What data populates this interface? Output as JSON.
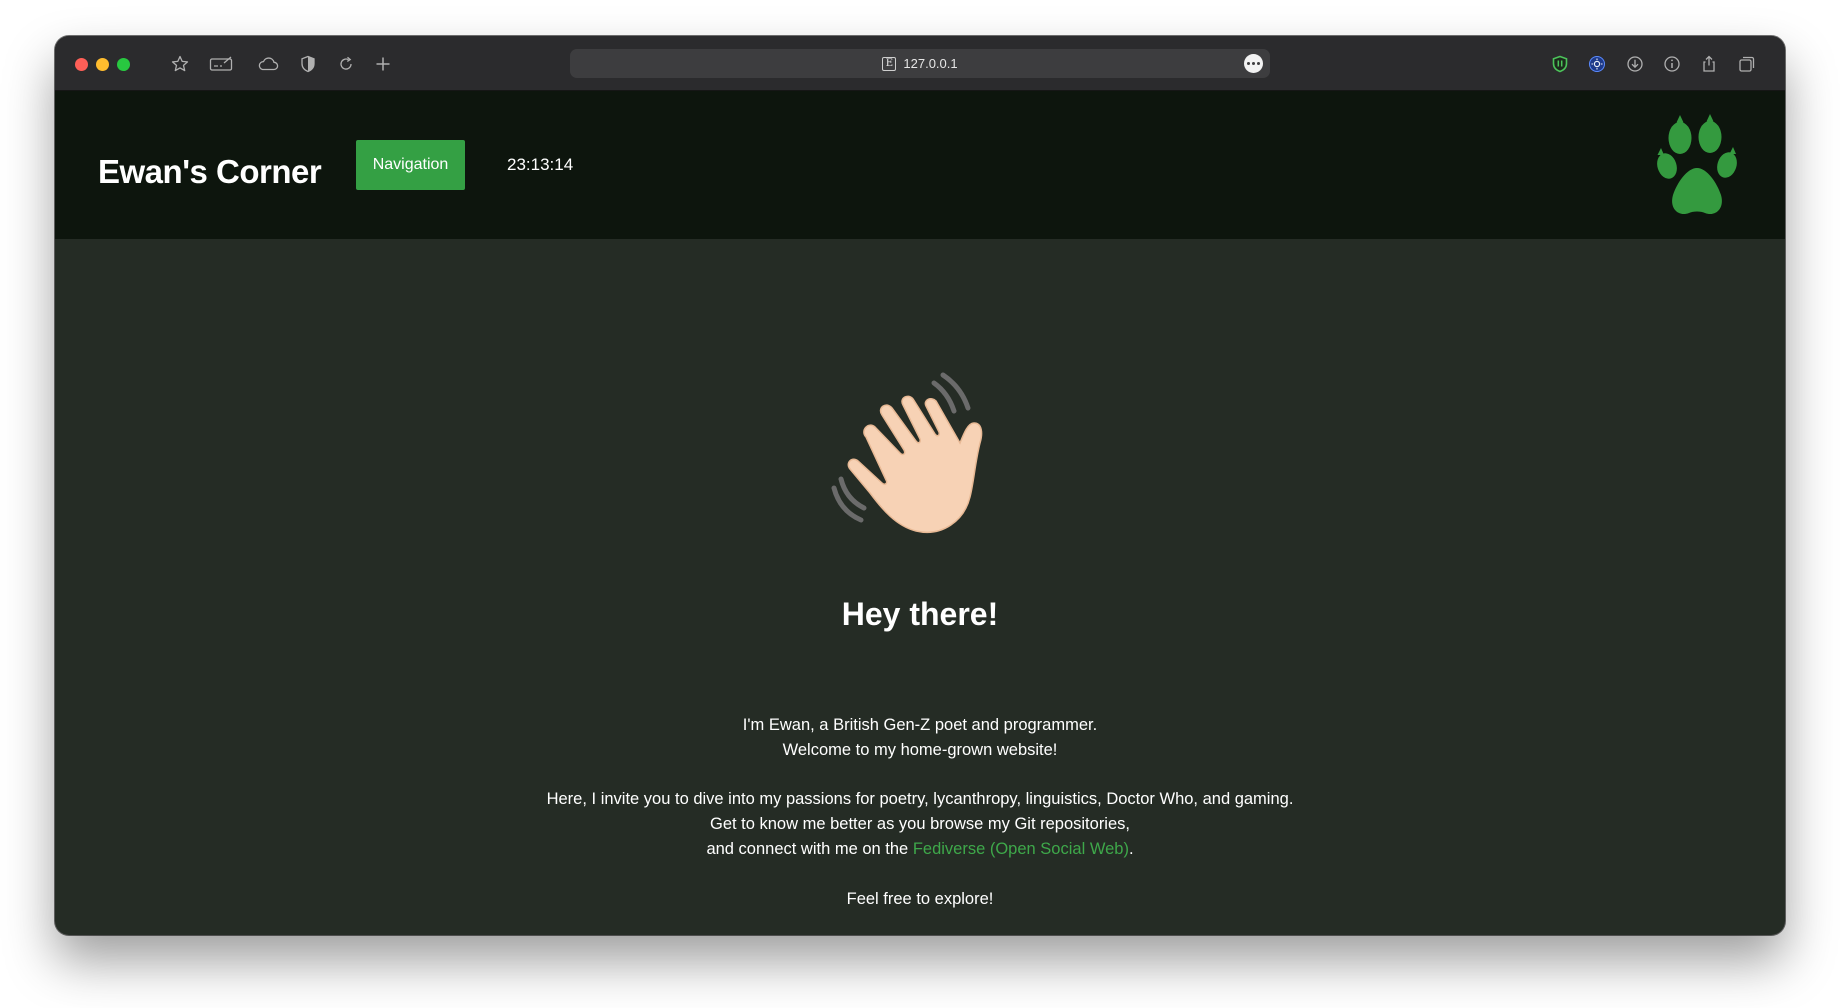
{
  "browser": {
    "url": "127.0.0.1",
    "site_badge": "E"
  },
  "header": {
    "title": "Ewan's Corner",
    "nav_label": "Navigation",
    "clock": "23:13:14",
    "logo_icon": "paw-icon",
    "accent_color": "#34a044"
  },
  "main": {
    "emoji": "👋",
    "greeting": "Hey there!",
    "intro_line1": "I'm Ewan, a British Gen-Z poet and programmer.",
    "intro_line2": "Welcome to my home-grown website!",
    "body_line1": "Here, I invite you to dive into my passions for poetry, lycanthropy, linguistics, Doctor Who, and gaming.",
    "body_line2": "Get to know me better as you browse my Git repositories,",
    "body_line3_prefix": "and connect with me on the ",
    "fediverse_link": "Fediverse (Open Social Web)",
    "body_line3_suffix": ".",
    "closing": "Feel free to explore!"
  }
}
